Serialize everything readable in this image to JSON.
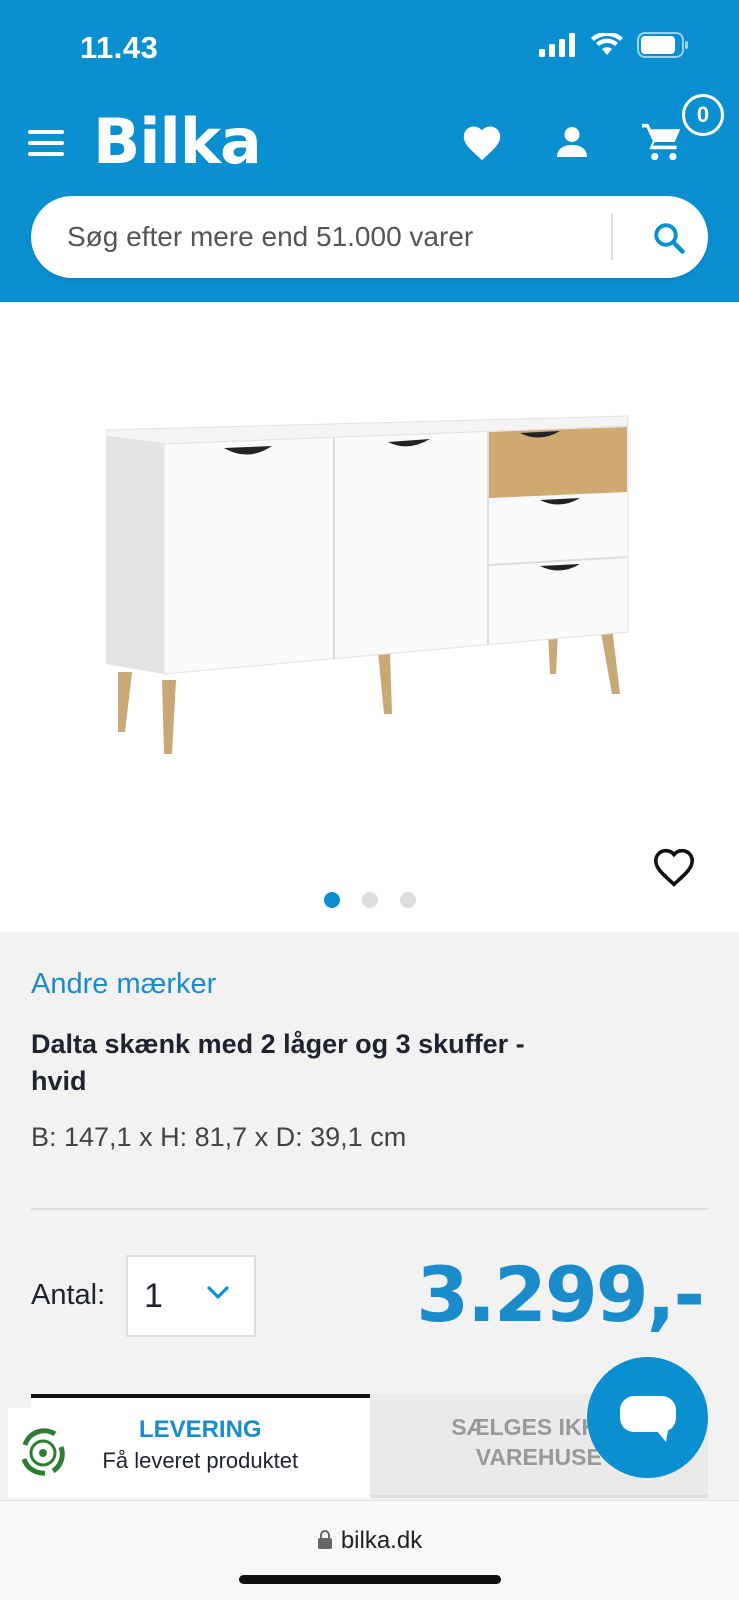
{
  "status": {
    "time": "11.43"
  },
  "header": {
    "logo": "Bilka",
    "cart_count": "0",
    "icons": [
      "menu-icon",
      "heart-icon",
      "user-icon",
      "cart-icon"
    ],
    "brand_color": "#0a8fd1"
  },
  "search": {
    "placeholder": "Søg efter mere end 51.000 varer"
  },
  "product": {
    "brand": "Andre mærker",
    "title": "Dalta skænk med 2 låger og 3 skuffer - hvid",
    "dimensions": "B: 147,1 x H: 81,7 x D: 39,1 cm",
    "image_count": 3,
    "active_image": 1,
    "price": "3.299,-",
    "price_color": "#1a8ccc"
  },
  "quantity": {
    "label": "Antal:",
    "value": "1"
  },
  "tabs": [
    {
      "title": "LEVERING",
      "subtitle": "Få leveret produktet",
      "active": true
    },
    {
      "title": "SÆLGES IKKE I VAREHUSE",
      "subtitle": "",
      "active": false
    }
  ],
  "browser": {
    "url": "bilka.dk"
  }
}
